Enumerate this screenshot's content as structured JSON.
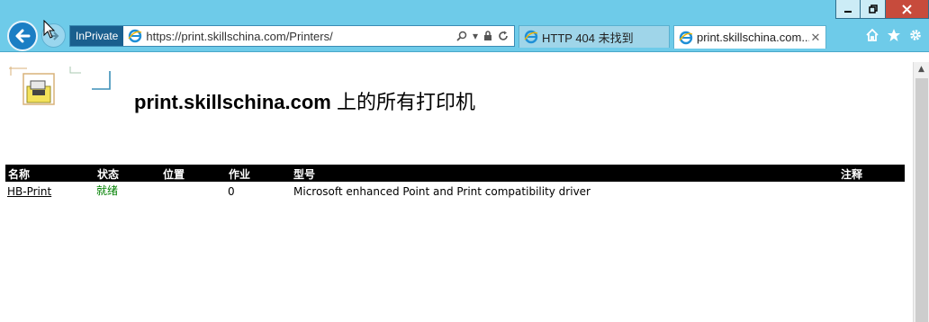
{
  "browser": {
    "inprivate_label": "InPrivate",
    "url": "https://print.skillschina.com/Printers/",
    "tabs": [
      {
        "title": "HTTP 404 未找到",
        "active": false
      },
      {
        "title": "print.skillschina.com...",
        "active": true
      }
    ],
    "window_controls": [
      "minimize",
      "restore",
      "close"
    ],
    "accent_color": "#6ecbe9"
  },
  "page": {
    "title_host": "print.skillschina.com",
    "title_suffix": " 上的所有打印机",
    "table": {
      "headers": {
        "name": "名称",
        "status": "状态",
        "location": "位置",
        "jobs": "作业",
        "model": "型号",
        "comment": "注释"
      },
      "rows": [
        {
          "name": "HB-Print",
          "status": "就绪",
          "location": "",
          "jobs": "0",
          "model": "Microsoft enhanced Point and Print compatibility driver",
          "comment": ""
        }
      ]
    }
  }
}
